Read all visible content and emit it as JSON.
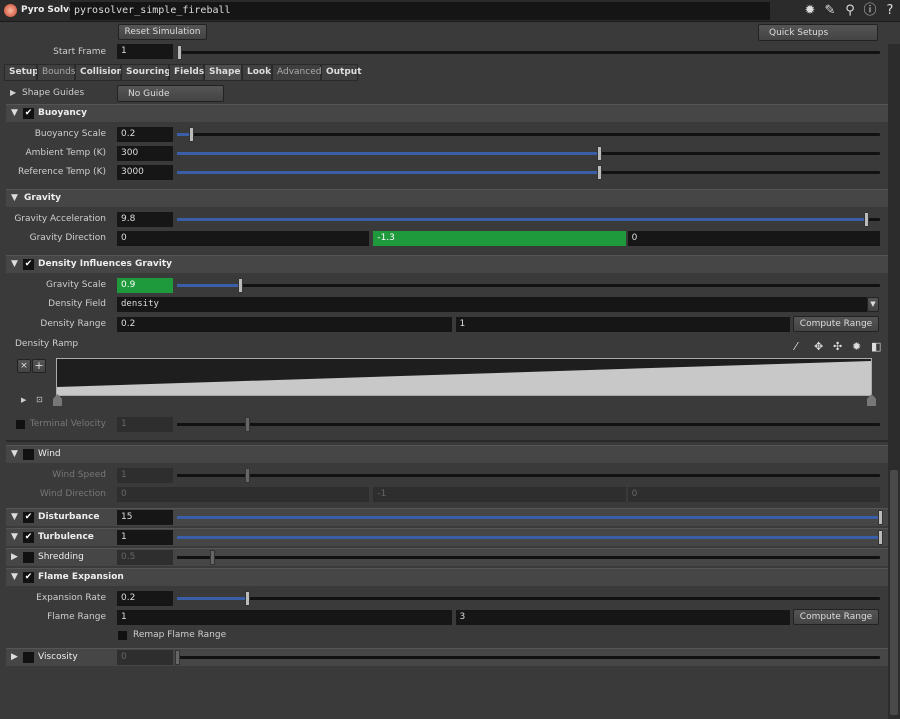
{
  "title": {
    "node_type": "Pyro Solver",
    "node_name": "pyrosolver_simple_fireball"
  },
  "toolbar_icons": [
    "gear-icon",
    "brush-icon",
    "search-icon",
    "info-icon",
    "help-icon"
  ],
  "toolbar_glyphs": [
    "✹",
    "✎",
    "⚲",
    "ⓘ",
    "?"
  ],
  "reset_label": "Reset Simulation",
  "quick_setups": "Quick Setups",
  "start_frame": {
    "label": "Start Frame",
    "value": "1"
  },
  "tabs": [
    "Setup",
    "Bounds",
    "Collision",
    "Sourcing",
    "Fields",
    "Shape",
    "Look",
    "Advanced",
    "Output"
  ],
  "active_tab": "Shape",
  "shape_guides": {
    "label": "Shape Guides",
    "value": "No Guide"
  },
  "sections": {
    "buoyancy": "Buoyancy",
    "gravity": "Gravity",
    "density_influences": "Density Influences Gravity",
    "wind": "Wind",
    "disturbance": "Disturbance",
    "turbulence": "Turbulence",
    "shredding": "Shredding",
    "flame_expansion": "Flame Expansion",
    "viscosity": "Viscosity"
  },
  "params": {
    "buoyancy_scale": {
      "label": "Buoyancy Scale",
      "value": "0.2",
      "slider": 0.02
    },
    "ambient_temp": {
      "label": "Ambient Temp (K)",
      "value": "300",
      "slider": 0.6
    },
    "reference_temp": {
      "label": "Reference Temp (K)",
      "value": "3000",
      "slider": 0.6
    },
    "gravity_accel": {
      "label": "Gravity Acceleration",
      "value": "9.8",
      "slider": 0.98
    },
    "gravity_dir": {
      "label": "Gravity Direction",
      "values": [
        "0",
        "-1.3",
        "0"
      ]
    },
    "gravity_scale": {
      "label": "Gravity Scale",
      "value": "0.9",
      "slider": 0.09
    },
    "density_field": {
      "label": "Density Field",
      "value": "density"
    },
    "density_range": {
      "label": "Density Range",
      "values": [
        "0.2",
        "1"
      ],
      "button": "Compute Range"
    },
    "density_ramp": {
      "label": "Density Ramp",
      "start": 0.0,
      "end": 1.0
    },
    "terminal_velocity": {
      "label": "Terminal Velocity",
      "value": "1",
      "slider": 0.1
    },
    "wind_speed": {
      "label": "Wind Speed",
      "value": "1",
      "slider": 0.1
    },
    "wind_dir": {
      "label": "Wind Direction",
      "values": [
        "0",
        "-1",
        "0"
      ]
    },
    "disturbance": {
      "value": "15",
      "slider": 1.0
    },
    "turbulence": {
      "value": "1",
      "slider": 1.0
    },
    "shredding": {
      "value": "0.5",
      "slider": 0.05
    },
    "expansion_rate": {
      "label": "Expansion Rate",
      "value": "0.2",
      "slider": 0.1
    },
    "flame_range": {
      "label": "Flame Range",
      "values": [
        "1",
        "3"
      ],
      "button": "Compute Range"
    },
    "remap_flame_range": {
      "label": "Remap Flame Range"
    },
    "viscosity": {
      "value": "0",
      "slider": 0.0
    }
  }
}
